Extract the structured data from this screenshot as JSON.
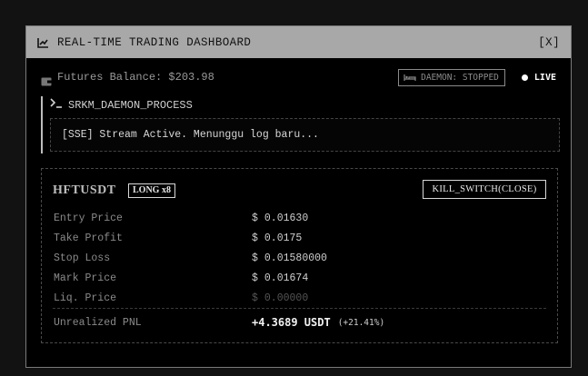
{
  "window": {
    "title": "REAL-TIME TRADING DASHBOARD",
    "close_label": "[X]"
  },
  "status": {
    "balance_text": "Futures Balance: $203.98",
    "daemon_status": "DAEMON: STOPPED",
    "live_label": "LIVE"
  },
  "process": {
    "name": "SRKM_DAEMON_PROCESS",
    "log_text": "[SSE] Stream Active. Menunggu log baru..."
  },
  "position": {
    "symbol": "HFTUSDT",
    "side_badge": "LONG x8",
    "kill_label": "KILL_SWITCH(CLOSE)",
    "rows": [
      {
        "label": "Entry Price",
        "currency": "$",
        "value": "0.01630"
      },
      {
        "label": "Take Profit",
        "currency": "$",
        "value": "0.0175"
      },
      {
        "label": "Stop Loss",
        "currency": "$",
        "value": "0.01580000"
      },
      {
        "label": "Mark Price",
        "currency": "$",
        "value": "0.01674"
      },
      {
        "label": "Liq. Price",
        "currency": "$",
        "value": "0.00000"
      }
    ],
    "pnl_label": "Unrealized PNL",
    "pnl_value": "+4.3689 USDT",
    "pnl_percent": "(+21.41%)"
  },
  "icons": {
    "title": "line-chart-icon",
    "balance": "wallet-icon",
    "daemon": "bed-icon",
    "live": "live-dot-icon",
    "process": "terminal-prompt-icon"
  },
  "colors": {
    "background": "#000000",
    "titlebar": "#a8a8a8",
    "text": "#bdbdbd",
    "muted": "#555555"
  }
}
